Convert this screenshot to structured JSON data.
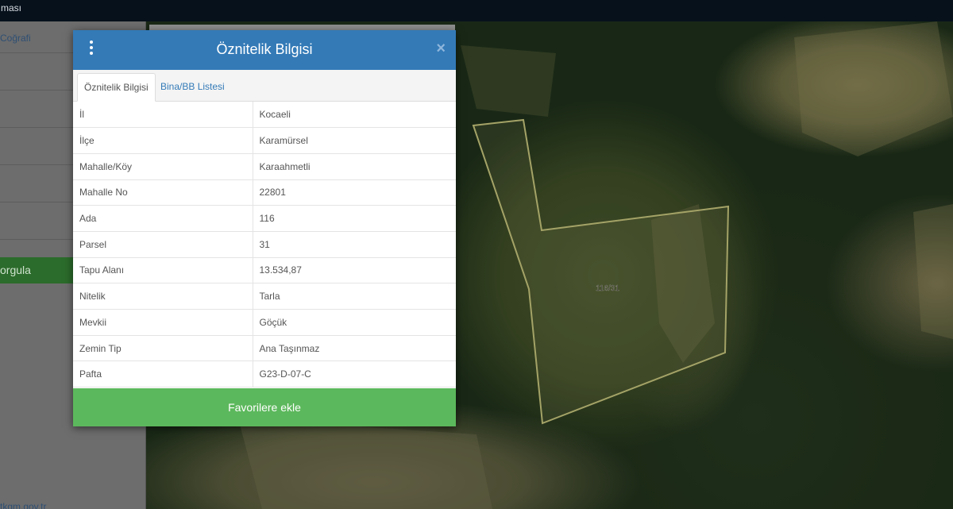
{
  "topbar": {
    "title_fragment": "ması"
  },
  "sidebar": {
    "first_item": "Coğrafi",
    "query_button": "orgula",
    "footer_link": "tkgm.gov.tr"
  },
  "map": {
    "parcel_label": "116/31",
    "parcel_outline_color": "#c9c77e"
  },
  "dialog": {
    "title": "Öznitelik Bilgisi",
    "close_glyph": "×",
    "tabs": [
      {
        "label": "Öznitelik Bilgisi",
        "active": true
      },
      {
        "label": "Bina/BB Listesi",
        "active": false
      }
    ],
    "rows": [
      {
        "key": "İl",
        "value": "Kocaeli"
      },
      {
        "key": "İlçe",
        "value": "Karamürsel"
      },
      {
        "key": "Mahalle/Köy",
        "value": "Karaahmetli"
      },
      {
        "key": "Mahalle No",
        "value": "22801"
      },
      {
        "key": "Ada",
        "value": "116"
      },
      {
        "key": "Parsel",
        "value": "31"
      },
      {
        "key": "Tapu Alanı",
        "value": "13.534,87"
      },
      {
        "key": "Nitelik",
        "value": "Tarla"
      },
      {
        "key": "Mevkii",
        "value": "Göçük"
      },
      {
        "key": "Zemin Tip",
        "value": "Ana Taşınmaz"
      },
      {
        "key": "Pafta",
        "value": "G23-D-07-C"
      }
    ],
    "favorite_button": "Favorilere ekle"
  },
  "colors": {
    "header_blue": "#337ab7",
    "button_green": "#5cb85c"
  },
  "icons": {
    "menu": "kebab-menu-icon",
    "close": "close-icon"
  }
}
